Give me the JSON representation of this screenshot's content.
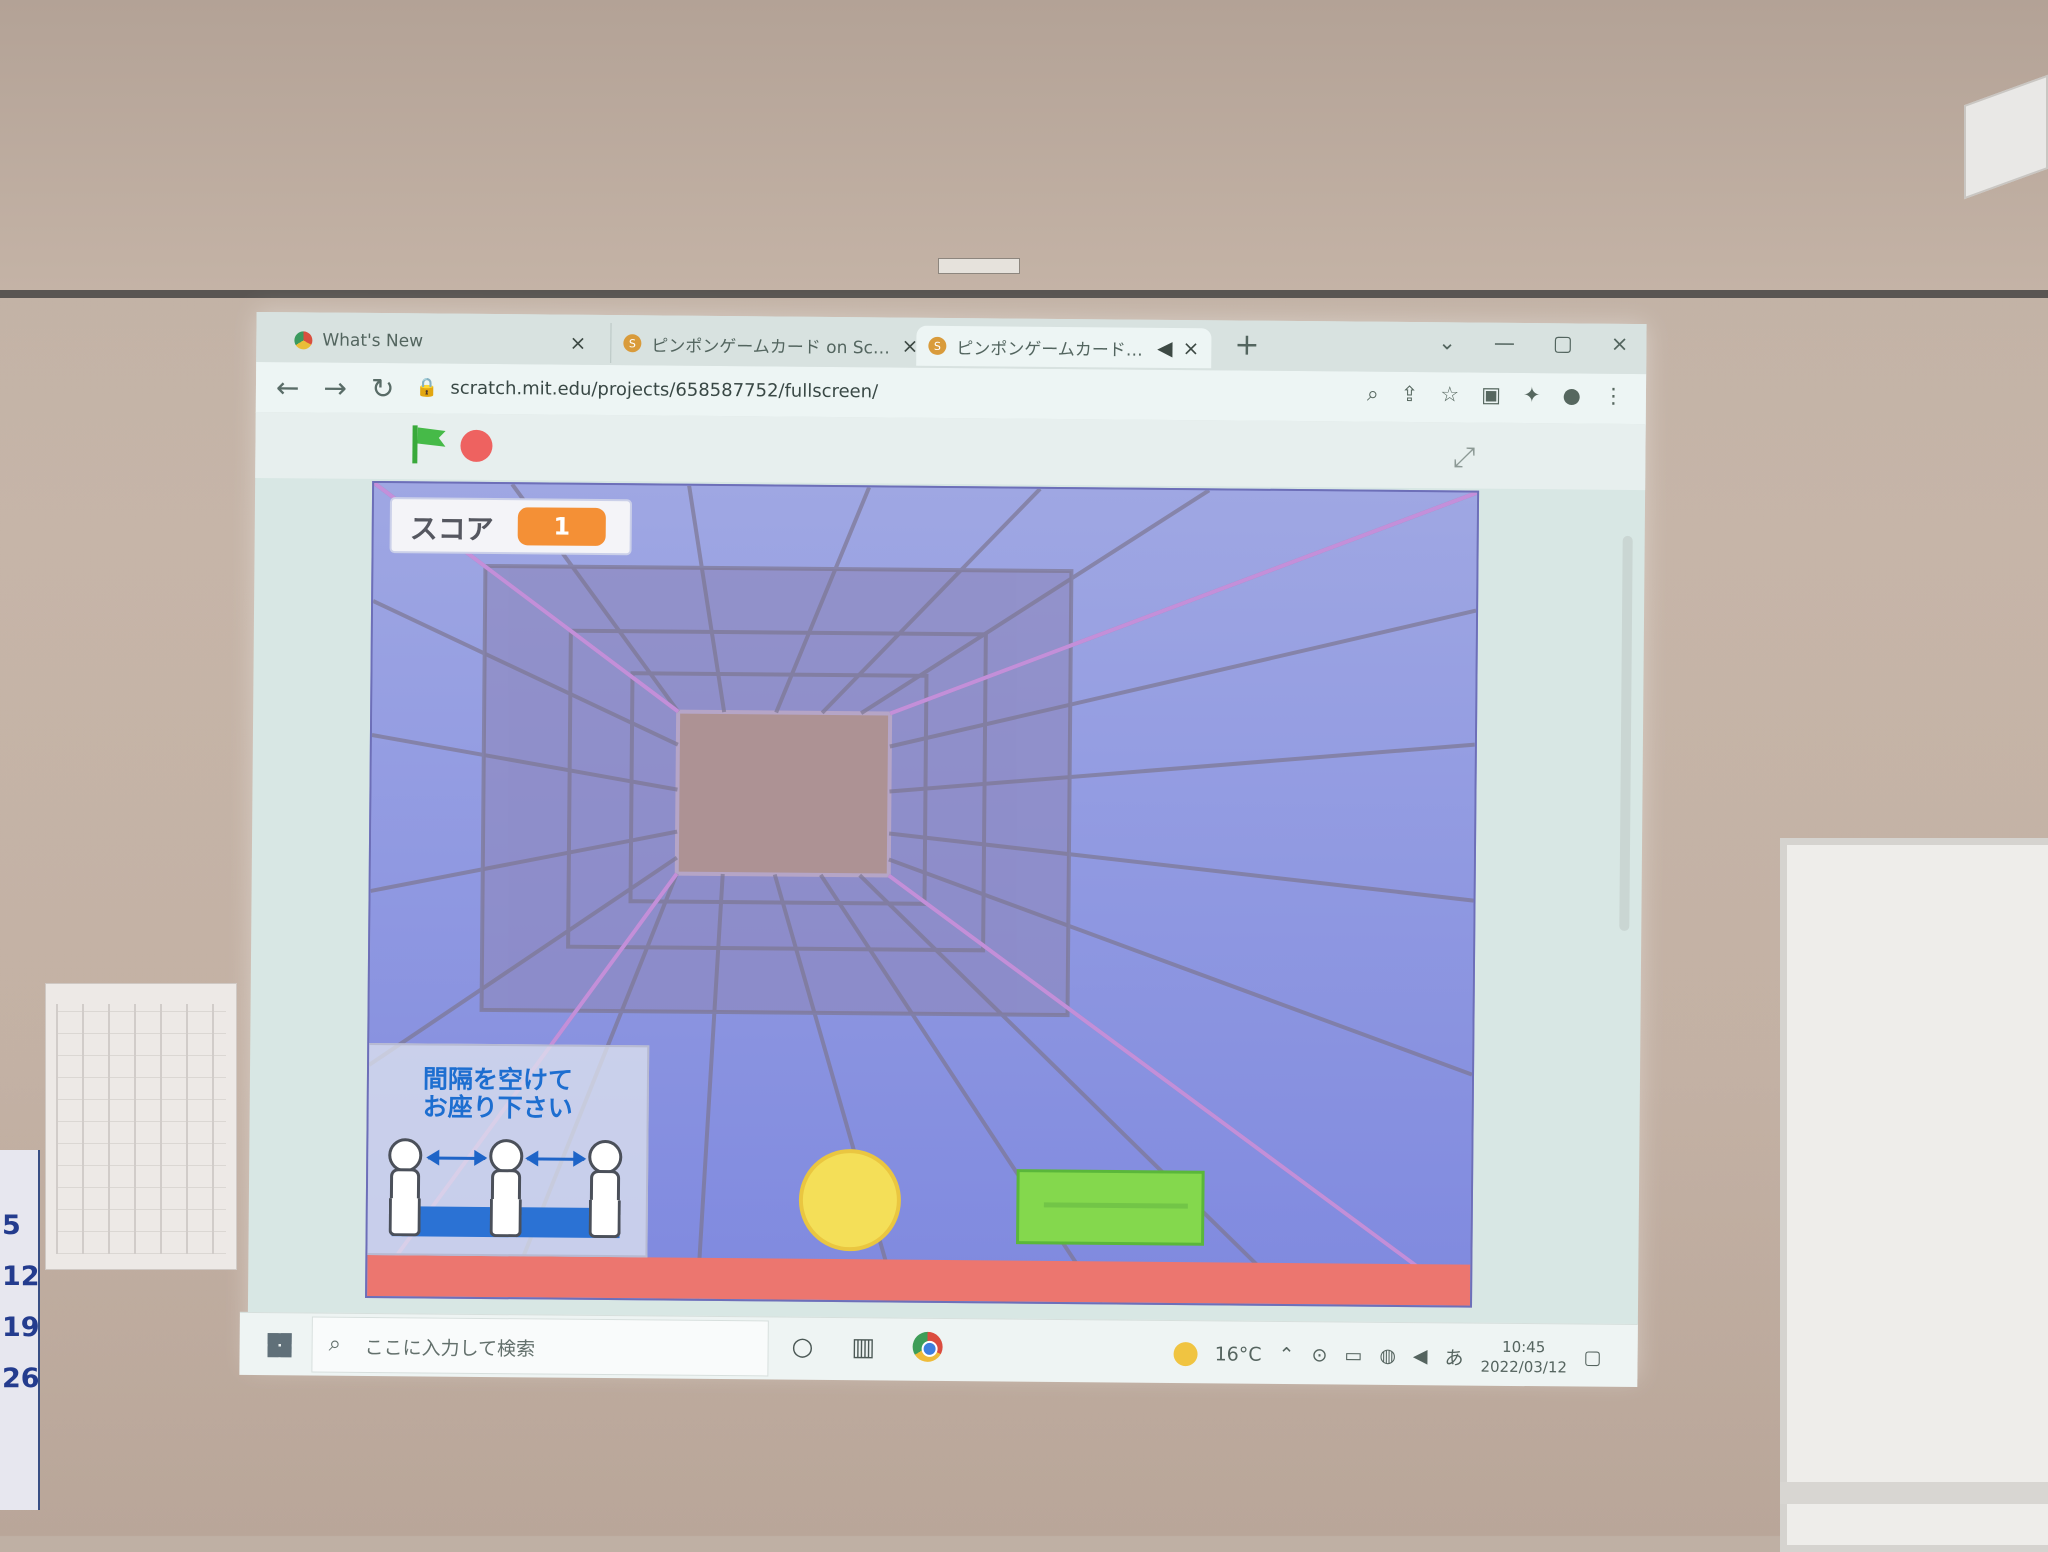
{
  "browser": {
    "tabs": [
      {
        "label": "What's New",
        "close_icon": "×"
      },
      {
        "label": "ピンポンゲームカード on Scratch",
        "close_icon": "×"
      },
      {
        "label": "ピンポンゲームカード on Scratch",
        "close_icon": "×",
        "audio_icon": "◀"
      }
    ],
    "new_tab_icon": "+",
    "window_controls": [
      "⌄",
      "—",
      "▢",
      "×"
    ],
    "address": "scratch.mit.edu/projects/658587752/fullscreen/",
    "nav_icons": [
      "←",
      "→",
      "↻"
    ],
    "right_icons": [
      "⌕",
      "⇪",
      "☆",
      "▣",
      "✦",
      "●",
      "⋮"
    ]
  },
  "scratch": {
    "score_label": "スコア",
    "score_value": "1",
    "notice_text": "間隔を空けて\nお座り下さい"
  },
  "taskbar": {
    "search_placeholder": "ここに入力して検索",
    "temperature": "16°C",
    "time": "10:45",
    "date": "2022/03/12",
    "ime": "あ"
  },
  "wall_calendar": {
    "dates": [
      "5",
      "12",
      "19",
      "26"
    ]
  }
}
